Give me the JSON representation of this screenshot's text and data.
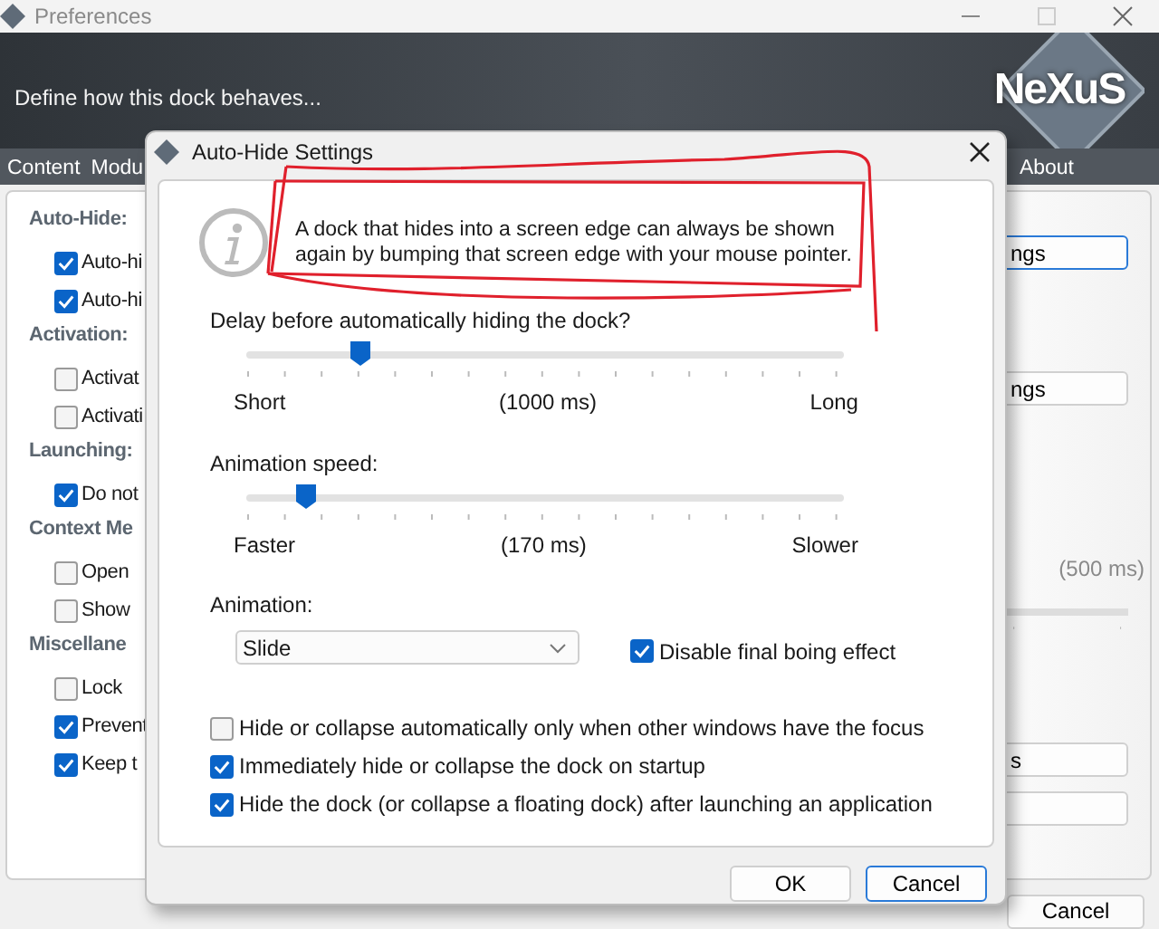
{
  "window": {
    "title": "Preferences"
  },
  "banner": {
    "subtitle": "Define how this dock behaves...",
    "logo": "NeXuS"
  },
  "tabs": [
    {
      "label": "Content",
      "selected": false
    },
    {
      "label": "Modu",
      "selected": false
    },
    {
      "label": "About",
      "selected": false
    }
  ],
  "groups": [
    {
      "heading": "Auto-Hide:",
      "items": [
        {
          "label": "Auto-hi",
          "checked": true
        },
        {
          "label": "Auto-hi",
          "checked": true
        }
      ]
    },
    {
      "heading": "Activation:",
      "items": [
        {
          "label": "Activat",
          "checked": false
        },
        {
          "label": "Activati",
          "checked": false
        }
      ]
    },
    {
      "heading": "Launching:",
      "items": [
        {
          "label": "Do not",
          "checked": true
        }
      ]
    },
    {
      "heading": "Context Me",
      "items": [
        {
          "label": "Open",
          "checked": false
        },
        {
          "label": "Show",
          "checked": false
        }
      ]
    },
    {
      "heading": "Miscellane",
      "items": [
        {
          "label": "Lock",
          "checked": false
        },
        {
          "label": "Prevent",
          "checked": true
        },
        {
          "label": "Keep t",
          "checked": true
        }
      ]
    }
  ],
  "right_side": [
    {
      "kind": "button",
      "label": "ngs",
      "focused": true
    },
    {
      "kind": "button",
      "label": "ngs",
      "focused": false
    },
    {
      "kind": "reading",
      "label": "(500 ms)"
    },
    {
      "kind": "slider"
    },
    {
      "kind": "button",
      "label": "s",
      "focused": false
    },
    {
      "kind": "button",
      "focused": false
    }
  ],
  "footer_buttons": [
    {
      "label": "Cancel",
      "focused": false
    }
  ],
  "dialog": {
    "title": "Auto-Hide Settings",
    "info": "A dock that hides into a screen edge can always be shown again by bumping that screen edge with your mouse pointer.",
    "sliders": [
      {
        "label": "Delay before automatically hiding the dock?",
        "level": 0.19,
        "min_label": "Short",
        "reading": "(1000 ms)",
        "max_label": "Long"
      },
      {
        "label": "Animation speed:",
        "level": 0.1,
        "min_label": "Faster",
        "reading": "(170 ms)",
        "max_label": "Slower"
      }
    ],
    "animation": {
      "label": "Animation:",
      "value": "Slide",
      "option": {
        "label": "Disable final boing effect",
        "checked": true
      }
    },
    "options": [
      {
        "label": "Hide or collapse automatically only when other windows have the focus",
        "checked": false
      },
      {
        "label": "Immediately hide or collapse the dock on startup",
        "checked": true
      },
      {
        "label": "Hide the dock (or collapse a floating dock) after launching an application",
        "checked": true
      }
    ],
    "buttons": [
      {
        "label": "OK",
        "focused": false
      },
      {
        "label": "Cancel",
        "focused": true
      }
    ]
  }
}
